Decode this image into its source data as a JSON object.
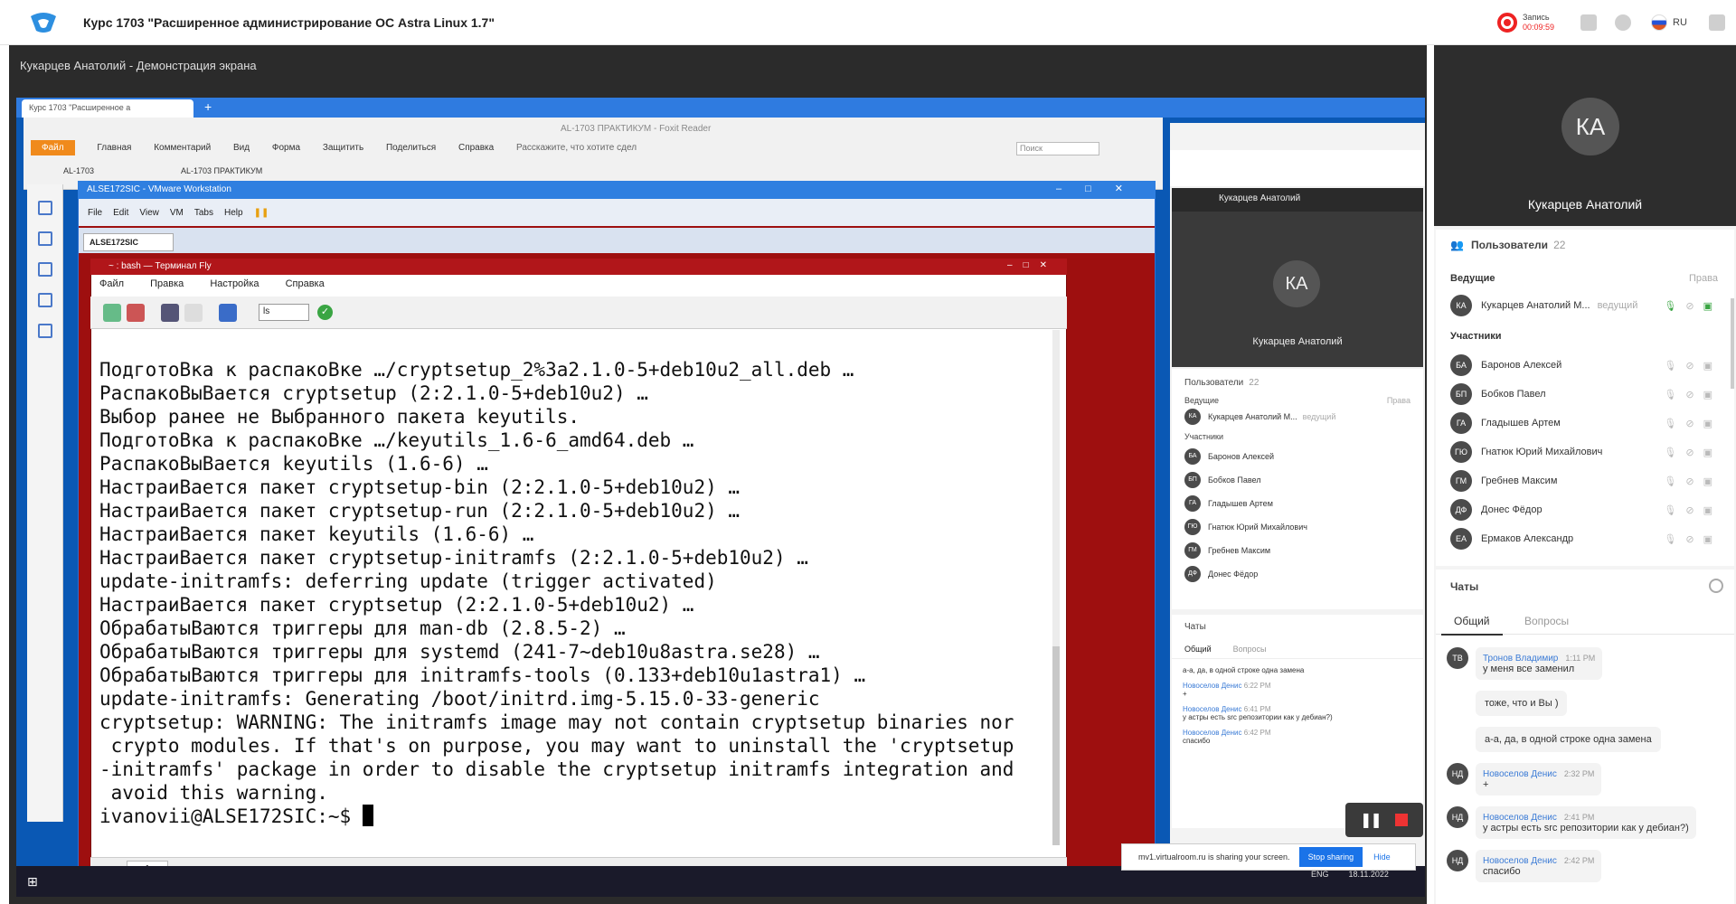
{
  "app": {
    "course_title": "Курс 1703 \"Расширенное администрирование ОС Astra Linux 1.7\"",
    "recording_label": "Запись",
    "recording_time": "00:09:59",
    "language": "RU",
    "demo_title": "Кукарцев Анатолий - Демонстрация экрана"
  },
  "remote": {
    "browser_tab": "Курс 1703 \"Расширенное а",
    "foxit_title": "AL-1703 ПРАКТИКУМ - Foxit Reader",
    "foxit_menu": [
      "Файл",
      "Главная",
      "Комментарий",
      "Вид",
      "Форма",
      "Защитить",
      "Поделиться",
      "Справка"
    ],
    "foxit_tellme": "Расскажите, что хотите сдел",
    "foxit_search": "Поиск",
    "foxit_tabs": [
      "AL-1703",
      "AL-1703 ПРАКТИКУМ"
    ],
    "vmware_title": "ALSE172SIC - VMware Workstation",
    "vmware_menu": [
      "File",
      "Edit",
      "View",
      "VM",
      "Tabs",
      "Help"
    ],
    "vmware_tab": "ALSE172SIC",
    "terminal_title": "~ : bash — Терминал Fly",
    "terminal_menu": [
      "Файл",
      "Правка",
      "Настройка",
      "Справка"
    ],
    "terminal_select": "ls",
    "terminal_lines": [
      "ПодготоВка к распакоВке …/cryptsetup_2%3a2.1.0-5+deb10u2_all.deb …",
      "РаспакоВыВается cryptsetup (2:2.1.0-5+deb10u2) …",
      "Выбор ранее не Выбранного пакета keyutils.",
      "ПодготоВка к распакоВке …/keyutils_1.6-6_amd64.deb …",
      "РаспакоВыВается keyutils (1.6-6) …",
      "НастраиВается пакет cryptsetup-bin (2:2.1.0-5+deb10u2) …",
      "НастраиВается пакет cryptsetup-run (2:2.1.0-5+deb10u2) …",
      "НастраиВается пакет keyutils (1.6-6) …",
      "НастраиВается пакет cryptsetup-initramfs (2:2.1.0-5+deb10u2) …",
      "update-initramfs: deferring update (trigger activated)",
      "НастраиВается пакет cryptsetup (2:2.1.0-5+deb10u2) …",
      "ОбрабатыВаются триггеры для man-db (2.8.5-2) …",
      "ОбрабатыВаются триггеры для systemd (241-7~deb10u8astra.se28) …",
      "ОбрабатыВаются триггеры для initramfs-tools (0.133+deb10u1astra1) …",
      "update-initramfs: Generating /boot/initrd.img-5.15.0-33-generic",
      "cryptsetup: WARNING: The initramfs image may not contain cryptsetup binaries nor",
      " crypto modules. If that's on purpose, you may want to uninstall the 'cryptsetup",
      "-initramfs' package in order to disable the cryptsetup initramfs integration and",
      " avoid this warning."
    ],
    "prompt": "ivanovii@ALSE172SIC:~$ ",
    "terminal_tab": "1",
    "share_text": "mv1.virtualroom.ru is sharing your screen.",
    "share_stop": "Stop sharing",
    "share_hide": "Hide",
    "tray_lang": "ENG",
    "tray_date": "18.11.2022",
    "mini": {
      "presenter": "Кукарцев Анатолий",
      "presenter_initials": "КА",
      "users_label": "Пользователи",
      "users_count": "22",
      "lead_label": "Ведущие",
      "rights_label": "Права",
      "lead_name": "Кукарцев Анатолий М...",
      "lead_role": "ведущий",
      "participants_label": "Участники",
      "participants": [
        {
          "initials": "БА",
          "name": "Баронов Алексей"
        },
        {
          "initials": "БП",
          "name": "Бобков Павел"
        },
        {
          "initials": "ГА",
          "name": "Гладышев Артем"
        },
        {
          "initials": "ГЮ",
          "name": "Гнатюк Юрий Михайлович"
        },
        {
          "initials": "ГМ",
          "name": "Гребнев Максим"
        },
        {
          "initials": "ДФ",
          "name": "Донес Фёдор"
        }
      ],
      "chats_label": "Чаты",
      "tab_general": "Общий",
      "tab_questions": "Вопросы",
      "messages": [
        {
          "initials": "",
          "name": "",
          "time": "",
          "text": "а-а, да, в одной строке одна замена"
        },
        {
          "initials": "НД",
          "name": "Новоселов Денис",
          "time": "6:22 PM",
          "text": "+"
        },
        {
          "initials": "НД",
          "name": "Новоселов Денис",
          "time": "6:41 PM",
          "text": "у астры есть src репозитории как у дебиан?)"
        },
        {
          "initials": "НД",
          "name": "Новоселов Денис",
          "time": "6:42 PM",
          "text": "спасибо"
        }
      ]
    }
  },
  "panel": {
    "presenter_initials": "КА",
    "presenter_name": "Кукарцев Анатолий",
    "users_label": "Пользователи",
    "users_count": "22",
    "lead_label": "Ведущие",
    "rights_label": "Права",
    "lead_initials": "КА",
    "lead_name": "Кукарцев Анатолий М...",
    "lead_role": "ведущий",
    "participants_label": "Участники",
    "participants": [
      {
        "initials": "БА",
        "name": "Баронов Алексей"
      },
      {
        "initials": "БП",
        "name": "Бобков Павел"
      },
      {
        "initials": "ГА",
        "name": "Гладышев Артем"
      },
      {
        "initials": "ГЮ",
        "name": "Гнатюк Юрий Михайлович"
      },
      {
        "initials": "ГМ",
        "name": "Гребнев Максим"
      },
      {
        "initials": "ДФ",
        "name": "Донес Фёдор"
      },
      {
        "initials": "ЕА",
        "name": "Ермаков Александр"
      }
    ],
    "chats_label": "Чаты",
    "tab_general": "Общий",
    "tab_questions": "Вопросы",
    "messages": [
      {
        "initials": "ТВ",
        "name": "Тронов Владимир",
        "time": "1:11 PM",
        "text": "у меня все заменил"
      },
      {
        "initials": "",
        "name": "",
        "time": "",
        "text": "тоже, что и Вы )"
      },
      {
        "initials": "",
        "name": "",
        "time": "",
        "text": "а-а, да, в одной строке одна замена"
      },
      {
        "initials": "НД",
        "name": "Новоселов Денис",
        "time": "2:32 PM",
        "text": "+"
      },
      {
        "initials": "НД",
        "name": "Новоселов Денис",
        "time": "2:41 PM",
        "text": "у астры есть src репозитории как у дебиан?)"
      },
      {
        "initials": "НД",
        "name": "Новоселов Денис",
        "time": "2:42 PM",
        "text": "спасибо"
      }
    ]
  },
  "colors": {
    "accent": "#3b7bd6",
    "recording": "#e22222",
    "terminal_frame": "#9e0f0f"
  }
}
